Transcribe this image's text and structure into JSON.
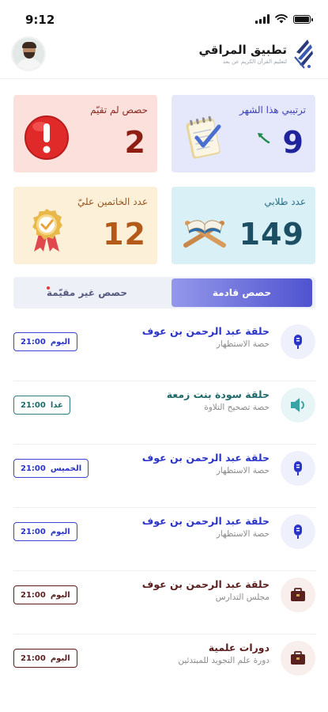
{
  "status_bar": {
    "time": "9:12"
  },
  "header": {
    "app_title": "تطبيق المراقي",
    "app_subtitle": "لتعليم القرآن الكريم عن بعد"
  },
  "stats": {
    "rank": {
      "label": "ترتيبي هذا الشهر",
      "value": "9"
    },
    "missed": {
      "label": "حصص لم تقيّم",
      "value": "2"
    },
    "students": {
      "label": "عدد طلابي",
      "value": "149"
    },
    "graduates": {
      "label": "عدد الخاتمين عليّ",
      "value": "12"
    }
  },
  "tabs": {
    "upcoming": "حصص قادمة",
    "unevaluated": "حصص غير مقيّمة"
  },
  "sessions": [
    {
      "title": "حلقة عبد الرحمن بن عوف",
      "subtitle": "حصة الاستظهار",
      "day": "اليوم",
      "time": "21:00",
      "icon": "microphone-icon",
      "theme": "blue"
    },
    {
      "title": "حلقة سودة بنت زمعة",
      "subtitle": "حصة تصحيح التلاوة",
      "day": "غدا",
      "time": "21:00",
      "icon": "speaker-icon",
      "theme": "teal"
    },
    {
      "title": "حلقة عبد الرحمن بن عوف",
      "subtitle": "حصة الاستظهار",
      "day": "الخميس",
      "time": "21:00",
      "icon": "microphone-icon",
      "theme": "blue"
    },
    {
      "title": "حلقة عبد الرحمن بن عوف",
      "subtitle": "حصة الاستظهار",
      "day": "اليوم",
      "time": "21:00",
      "icon": "microphone-icon",
      "theme": "blue"
    },
    {
      "title": "حلقة عبد الرحمن بن عوف",
      "subtitle": "مجلس التدارس",
      "day": "اليوم",
      "time": "21:00",
      "icon": "briefcase-icon",
      "theme": "brown"
    },
    {
      "title": "دورات علمية",
      "subtitle": "دورة علم التجويد للمبتدئين",
      "day": "اليوم",
      "time": "21:00",
      "icon": "briefcase-icon",
      "theme": "brown"
    }
  ],
  "colors": {
    "accent": "#4f53cf",
    "blue": "#2a34c8",
    "teal": "#1f6a6a",
    "brown": "#5a1f1f"
  }
}
